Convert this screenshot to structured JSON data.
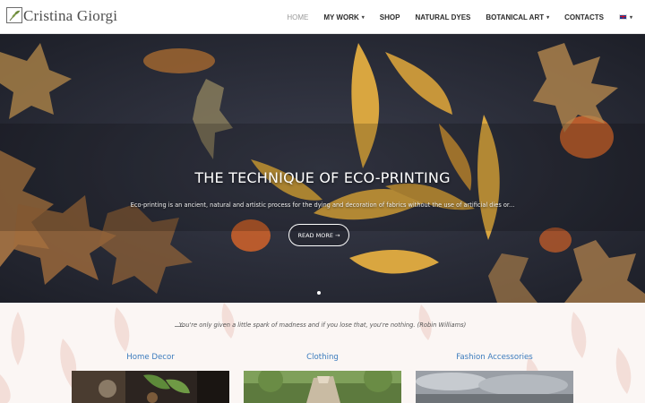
{
  "brand": {
    "name": "Cristina Giorgi"
  },
  "nav": {
    "items": [
      {
        "label": "HOME",
        "active": true,
        "dropdown": false
      },
      {
        "label": "MY WORK",
        "active": false,
        "dropdown": true
      },
      {
        "label": "SHOP",
        "active": false,
        "dropdown": false
      },
      {
        "label": "NATURAL DYES",
        "active": false,
        "dropdown": false
      },
      {
        "label": "BOTANICAL ART",
        "active": false,
        "dropdown": true
      }
    ],
    "contacts_label": "CONTACTS",
    "language_icon": "uk-flag-icon"
  },
  "hero": {
    "title": "THE TECHNIQUE OF ECO-PRINTING",
    "description": "Eco-printing is an ancient, natural and artistic process for the dying and decoration of fabrics without the use of artificial dies or...",
    "button_label": "READ MORE →",
    "slide_index": 1
  },
  "quote": "You're only given a little spark of madness and if you lose that, you're nothing. (Robin Williams)",
  "categories": [
    {
      "title": "Home Decor"
    },
    {
      "title": "Clothing"
    },
    {
      "title": "Fashion Accessories"
    }
  ],
  "colors": {
    "accent": "#3b7bbd",
    "hero_bg": "#2a2d3a",
    "leaf": "#d9a640"
  }
}
